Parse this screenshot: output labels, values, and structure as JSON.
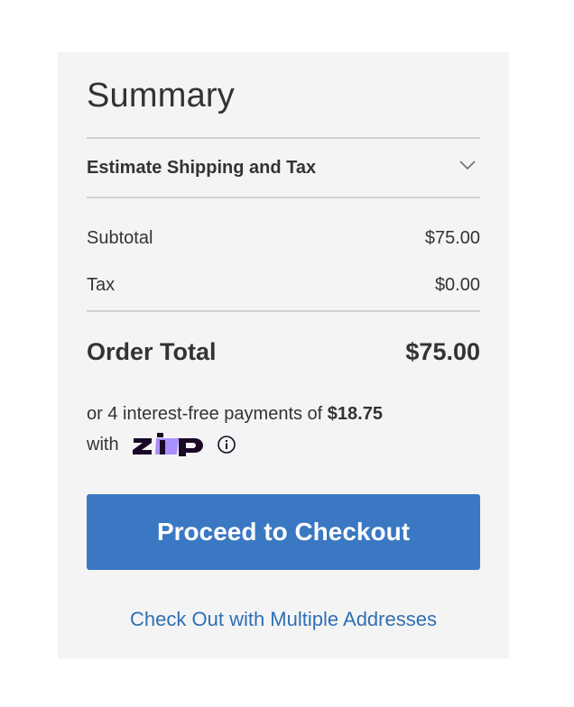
{
  "summary": {
    "title": "Summary",
    "estimate_label": "Estimate Shipping and Tax",
    "subtotal_label": "Subtotal",
    "subtotal_value": "$75.00",
    "tax_label": "Tax",
    "tax_value": "$0.00",
    "total_label": "Order Total",
    "total_value": "$75.00"
  },
  "zip": {
    "text_before": "or 4 interest-free payments of ",
    "amount": "$18.75",
    "text_with": "with",
    "logo_text": "zip"
  },
  "actions": {
    "checkout_label": "Proceed to Checkout",
    "multi_address_label": "Check Out with Multiple Addresses"
  },
  "colors": {
    "panel_bg": "#f4f4f4",
    "button_bg": "#3a78c3",
    "link": "#2f6fb4",
    "zip_purple": "#1a0826",
    "zip_lavender": "#aa8fff"
  },
  "icons": {
    "estimate_toggle": "chevron-down-icon",
    "zip_info": "info-icon"
  }
}
